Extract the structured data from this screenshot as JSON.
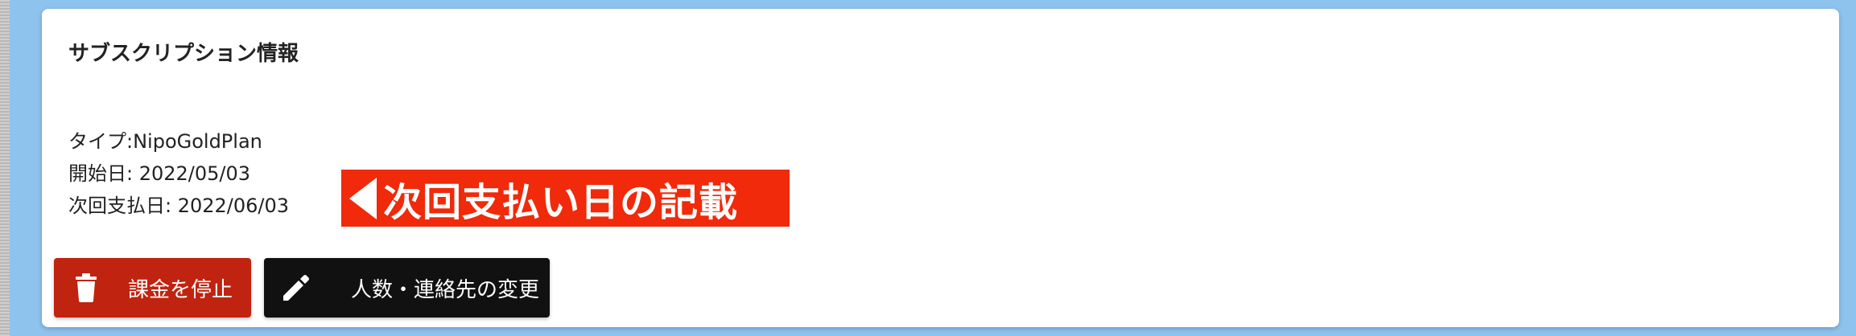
{
  "subscription": {
    "title": "サブスクリプション情報",
    "type_line": "タイプ:NipoGoldPlan",
    "start_line": "開始日: 2022/05/03",
    "next_payment_line": "次回支払日: 2022/06/03"
  },
  "annotation": {
    "text": "次回支払い日の記載",
    "color": "#f02a0a"
  },
  "actions": {
    "stop_label": "課金を停止",
    "stop_icon": "trash-icon",
    "stop_color": "#c0230f",
    "change_label": "人数・連絡先の変更",
    "change_icon": "pencil-icon",
    "change_color": "#111111"
  },
  "colors": {
    "page_background": "#8ec3ee",
    "card_background": "#ffffff"
  }
}
